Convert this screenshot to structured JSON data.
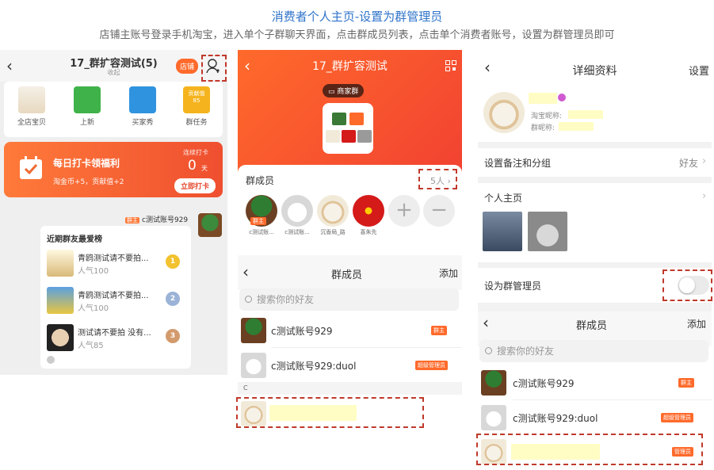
{
  "doc": {
    "title": "消费者个人主页-设置为群管理员",
    "subtitle": "店铺主账号登录手机淘宝，进入单个子群聊天界面，点击群成员列表，点击单个消费者账号，设置为群管理员即可"
  },
  "panel1": {
    "group_title": "17_群扩容测试(5)",
    "collapse_label": "收起",
    "shop_button": "店铺",
    "shortcuts": [
      {
        "label": "全店宝贝",
        "icon": "perfume-icon"
      },
      {
        "label": "上新",
        "icon": "new-arrival-icon"
      },
      {
        "label": "买家秀",
        "icon": "buyer-show-icon"
      },
      {
        "label": "群任务",
        "icon": "contribution-icon",
        "badge_top": "贡献值",
        "badge_value": "85"
      }
    ],
    "checkin": {
      "title": "每日打卡领福利",
      "reward": "淘金币+5，贡献值+2",
      "streak_label": "连续打卡",
      "streak_value": "0",
      "streak_unit": "天",
      "button": "立即打卡"
    },
    "chat": {
      "owner_badge": "群主",
      "sender": "c测试账号929",
      "card_title": "近期群友最爱榜",
      "items": [
        {
          "name": "青鸥测试请不要拍...",
          "popularity": "人气100",
          "rank": "1"
        },
        {
          "name": "青鸥测试请不要拍...",
          "popularity": "人气100",
          "rank": "2"
        },
        {
          "name": "测试请不要拍 没有...",
          "popularity": "人气85",
          "rank": "3"
        }
      ]
    }
  },
  "panel2": {
    "group_title": "17_群扩容测试",
    "merchant_badge": "商家群",
    "members_title": "群成员",
    "members_count": "5人",
    "members": [
      {
        "name": "c测试账...",
        "tag": "群主"
      },
      {
        "name": "c测试账..."
      },
      {
        "name": "沉香局_路"
      },
      {
        "name": "喜朱先"
      }
    ],
    "add_symbol": "+",
    "remove_symbol": "−"
  },
  "panel3": {
    "title": "群成员",
    "add": "添加",
    "search_placeholder": "搜索你的好友",
    "rows": [
      {
        "name": "c测试账号929",
        "tag": "群主"
      },
      {
        "name": "c测试账号929:duol",
        "tag": "超级管理员"
      }
    ],
    "section_letter": "C"
  },
  "panel4": {
    "title": "详细资料",
    "settings": "设置",
    "taobao_nick_label": "淘宝昵称:",
    "group_nick_label": "群昵称:",
    "remark_label": "设置备注和分组",
    "remark_value": "好友",
    "homepage_label": "个人主页",
    "admin_label": "设为群管理员",
    "admin_enabled": false
  },
  "panel5": {
    "title": "群成员",
    "add": "添加",
    "search_placeholder": "搜索你的好友",
    "rows": [
      {
        "name": "c测试账号929",
        "tag": "群主"
      },
      {
        "name": "c测试账号929:duol",
        "tag": "超级管理员"
      },
      {
        "name": "",
        "tag": "管理员"
      }
    ]
  },
  "colors": {
    "accent": "#ff6a2b",
    "title_blue": "#2f73c9",
    "highlight_border": "#c0392b",
    "redacted_yellow": "#fffdc4"
  }
}
